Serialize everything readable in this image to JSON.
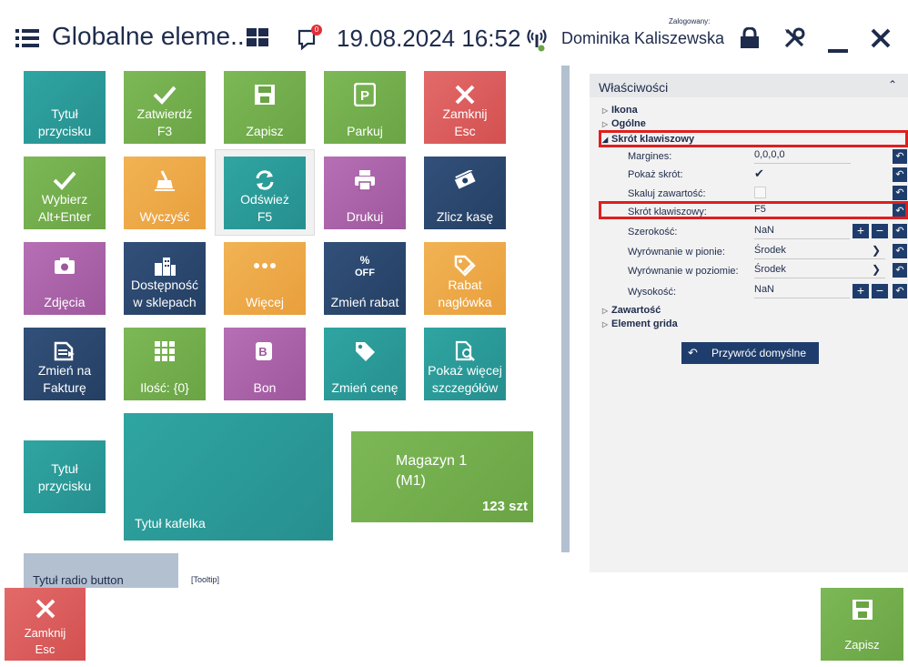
{
  "header": {
    "title": "Globalne eleme...",
    "datetime": "19.08.2024 16:52",
    "notification_count": "0",
    "user_caption": "Zalogowany:",
    "user_name": "Dominika Kaliszewska",
    "icons": [
      "menu-icon",
      "grid-view-icon",
      "notification-icon",
      "connection-status-icon",
      "lock-icon",
      "tools-icon",
      "minimize-icon",
      "close-icon"
    ]
  },
  "tiles": [
    {
      "label": "Tytuł\nprzycisku",
      "icon": "none",
      "color": "#2fa5a1"
    },
    {
      "label": "Zatwierdź\nF3",
      "icon": "checkmark-icon",
      "color": "#7db857"
    },
    {
      "label": "Zapisz",
      "icon": "save-icon",
      "color": "#7db857"
    },
    {
      "label": "Parkuj",
      "icon": "parking-icon",
      "color": "#7db857"
    },
    {
      "label": "Zamknij\nEsc",
      "icon": "close-icon",
      "color": "#e36a6a"
    },
    {
      "label": "Wybierz\nAlt+Enter",
      "icon": "checkmark-icon",
      "color": "#7db857"
    },
    {
      "label": "Wyczyść",
      "icon": "broom-icon",
      "color": "#f1b354"
    },
    {
      "label": "Odśwież\nF5",
      "icon": "refresh-icon",
      "color": "#2fa5a1"
    },
    {
      "label": "Drukuj",
      "icon": "printer-icon",
      "color": "#b66fb4"
    },
    {
      "label": "Zlicz kasę",
      "icon": "cash-icon",
      "color": "#32507a"
    },
    {
      "label": "Zdjęcia",
      "icon": "camera-icon",
      "color": "#b66fb4"
    },
    {
      "label": "Dostępność\nw sklepach",
      "icon": "buildings-icon",
      "color": "#32507a"
    },
    {
      "label": "Więcej",
      "icon": "more-dots-icon",
      "color": "#f1b354"
    },
    {
      "label": "Zmień rabat",
      "icon": "discount-icon",
      "color": "#32507a"
    },
    {
      "label": "Rabat\nnagłówka",
      "icon": "tag-edit-icon",
      "color": "#f1b354"
    },
    {
      "label": "Zmień na\nFakturę",
      "icon": "document-icon",
      "color": "#32507a"
    },
    {
      "label": "Ilość: {0}",
      "icon": "keypad-icon",
      "color": "#7db857"
    },
    {
      "label": "Bon",
      "icon": "voucher-icon",
      "color": "#b66fb4"
    },
    {
      "label": "Zmień cenę",
      "icon": "price-tag-icon",
      "color": "#2fa5a1"
    },
    {
      "label": "Pokaż więcej\nszczegółów",
      "icon": "document-search-icon",
      "color": "#2fa5a1"
    },
    {
      "label": "Tytuł\nprzycisku",
      "icon": "none",
      "color": "#2fa5a1"
    }
  ],
  "big_tile": {
    "label": "Tytuł kafelka"
  },
  "warehouse_tile": {
    "name": "Magazyn 1",
    "code": "(M1)",
    "quantity": "123 szt"
  },
  "radio_tile": {
    "label": "Tytuł radio button",
    "tooltip": "[Tooltip]"
  },
  "panel": {
    "title": "Właściwości",
    "sections": {
      "icon": "Ikona",
      "general": "Ogólne",
      "shortcut": "Skrót klawiszowy",
      "content": "Zawartość",
      "grid_element": "Element grida"
    },
    "props": {
      "margins_label": "Margines:",
      "margins_value": "0,0,0,0",
      "show_shortcut_label": "Pokaż skrót:",
      "show_shortcut_checked": true,
      "scale_label": "Skaluj zawartość:",
      "scale_checked": false,
      "shortcut_label": "Skrót klawiszowy:",
      "shortcut_value": "F5",
      "width_label": "Szerokość:",
      "width_value": "NaN",
      "valign_label": "Wyrównanie w pionie:",
      "valign_value": "Środek",
      "halign_label": "Wyrównanie w poziomie:",
      "halign_value": "Środek",
      "height_label": "Wysokość:",
      "height_value": "NaN"
    },
    "restore_label": "Przywróć domyślne"
  },
  "footer": {
    "close_label": "Zamknij\nEsc",
    "save_label": "Zapisz"
  },
  "colors": {
    "accent_navy": "#1f3d6c",
    "highlight_red": "#e01e1e",
    "teal": "#2fa5a1",
    "green": "#7db857"
  }
}
